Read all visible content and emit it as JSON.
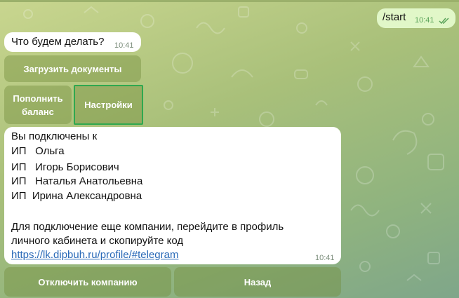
{
  "chat": {
    "outgoing": {
      "text": "/start",
      "time": "10:41"
    },
    "prompt": {
      "text": "Что будем делать?",
      "time": "10:41"
    },
    "keyboard1": {
      "upload_label": "Загрузить документы",
      "topup_label": "Пополнить баланс",
      "settings_label": "Настройки"
    },
    "info": {
      "line1": "Вы подключены к",
      "companies": [
        "ИП   Ольга",
        "ИП   Игорь Борисович",
        "ИП   Наталья Анатольевна",
        "ИП  Ирина Александровна"
      ],
      "instruction_1": "Для подключение еще компании, перейдите в профиль",
      "instruction_2": "личного кабинета и скопируйте код",
      "link": "https://lk.dipbuh.ru/profile/#telegram",
      "time": "10:41"
    },
    "keyboard2": {
      "disconnect_label": "Отключить компанию",
      "back_label": "Назад"
    }
  },
  "colors": {
    "background_top": "#c9d68f",
    "background_bottom": "#7fa68a",
    "outgoing_bubble": "#e1f7c8",
    "keyboard_button": "#8fa55a",
    "selected_border": "#2fa84f",
    "link": "#2a6ab8"
  },
  "icons": {
    "read_receipt": "double-check-icon"
  }
}
